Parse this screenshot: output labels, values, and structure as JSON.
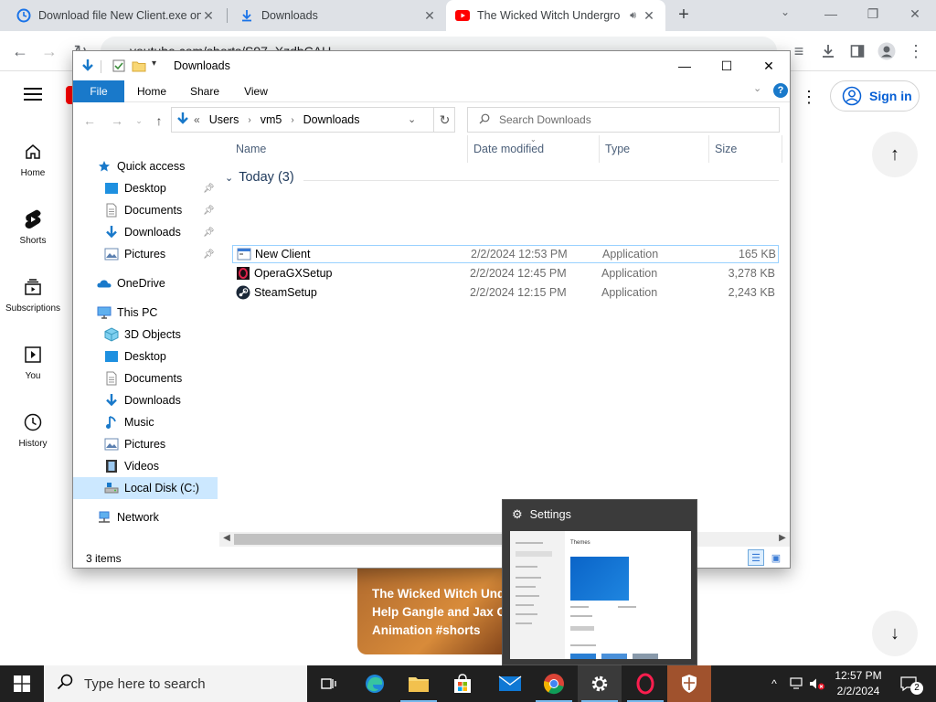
{
  "browser": {
    "tabs": [
      {
        "label": "Download file New Client.exe on",
        "icon": "edge-refresh-icon"
      },
      {
        "label": "Downloads",
        "icon": "download-icon"
      },
      {
        "label": "The Wicked Witch Undergro",
        "icon": "youtube-icon",
        "audio": true
      }
    ],
    "new_tab": "+",
    "url": "youtube.com/shorts/S97_XzdbCAU"
  },
  "youtube": {
    "nav": [
      {
        "label": "Home",
        "icon": "home-icon"
      },
      {
        "label": "Shorts",
        "icon": "shorts-icon"
      },
      {
        "label": "Subscriptions",
        "icon": "subscriptions-icon"
      },
      {
        "label": "You",
        "icon": "you-icon"
      },
      {
        "label": "History",
        "icon": "history-icon"
      }
    ],
    "sign_in": "Sign in",
    "short_title": "The Wicked Witch Under Help Gangle and Jax Co Animation #shorts",
    "short_title_lines": [
      "The Wicked Witch Unde",
      "Help Gangle and Jax Co",
      "Animation #shorts"
    ]
  },
  "explorer": {
    "title": "Downloads",
    "ribbon_tabs": [
      "File",
      "Home",
      "Share",
      "View"
    ],
    "breadcrumb": [
      "Users",
      "vm5",
      "Downloads"
    ],
    "breadcrumb_prefix": "«",
    "search_placeholder": "Search Downloads",
    "nav": {
      "quick_access": "Quick access",
      "quick_items": [
        "Desktop",
        "Documents",
        "Downloads",
        "Pictures"
      ],
      "onedrive": "OneDrive",
      "this_pc": "This PC",
      "pc_items": [
        "3D Objects",
        "Desktop",
        "Documents",
        "Downloads",
        "Music",
        "Pictures",
        "Videos",
        "Local Disk (C:)"
      ],
      "network": "Network"
    },
    "columns": [
      "Name",
      "Date modified",
      "Type",
      "Size"
    ],
    "group": "Today (3)",
    "files": [
      {
        "name": "New Client",
        "date": "2/2/2024 12:53 PM",
        "type": "Application",
        "size": "165 KB"
      },
      {
        "name": "OperaGXSetup",
        "date": "2/2/2024 12:45 PM",
        "type": "Application",
        "size": "3,278 KB"
      },
      {
        "name": "SteamSetup",
        "date": "2/2/2024 12:15 PM",
        "type": "Application",
        "size": "2,243 KB"
      }
    ],
    "status": "3 items"
  },
  "preview": {
    "title": "Settings",
    "theme_heading": "Themes"
  },
  "taskbar": {
    "search_placeholder": "Type here to search",
    "time": "12:57 PM",
    "date": "2/2/2024",
    "notification_count": "2"
  },
  "colors": {
    "file_tab_blue": "#1979ca",
    "signin_blue": "#065fd4",
    "taskbar": "#202020",
    "yt_red": "#ff0000"
  }
}
